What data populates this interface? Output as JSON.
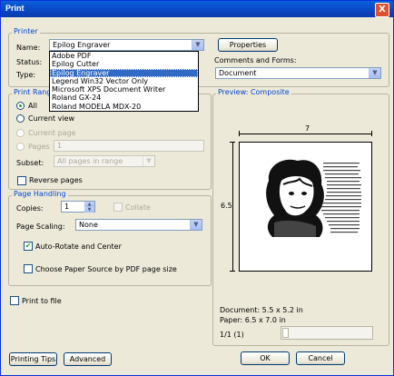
{
  "window": {
    "title": "Print",
    "close_glyph": "X"
  },
  "printer": {
    "group_label": "Printer",
    "name_label": "Name:",
    "name_value": "Epilog Engraver",
    "status_label": "Status:",
    "type_label": "Type:",
    "properties_label": "Properties",
    "comments_label": "Comments and Forms:",
    "comments_value": "Document",
    "dropdown_items": [
      {
        "label": "Adobe PDF"
      },
      {
        "label": "Epilog Cutter"
      },
      {
        "label": "Epilog Engraver"
      },
      {
        "label": "Legend Win32 Vector Only"
      },
      {
        "label": "Microsoft XPS Document Writer"
      },
      {
        "label": "Roland GX-24"
      },
      {
        "label": "Roland MODELA MDX-20"
      }
    ]
  },
  "print_range": {
    "group_label": "Print Rang",
    "all_label": "All",
    "current_view_label": "Current view",
    "current_page_label": "Current page",
    "pages_label": "Pages",
    "pages_value": "1",
    "subset_label": "Subset:",
    "subset_value": "All pages in range",
    "reverse_label": "Reverse pages"
  },
  "page_handling": {
    "group_label": "Page Handling",
    "copies_label": "Copies:",
    "copies_value": "1",
    "collate_label": "Collate",
    "scaling_label": "Page Scaling:",
    "scaling_value": "None",
    "auto_rotate_label": "Auto-Rotate and Center",
    "choose_source_label": "Choose Paper Source by PDF page size"
  },
  "print_to_file_label": "Print to file",
  "preview": {
    "group_label": "Preview: Composite",
    "width_value": "7",
    "height_value": "6.5",
    "document_size": "Document: 5.5 x 5.2 in",
    "paper_size": "Paper: 6.5 x 7.0 in",
    "page_indicator": "1/1 (1)"
  },
  "buttons": {
    "printing_tips": "Printing Tips",
    "advanced": "Advanced",
    "ok": "OK",
    "cancel": "Cancel"
  },
  "colors": {
    "title_bar": "#0a46c4",
    "group_label": "#0046d5",
    "selection": "#316ac5"
  }
}
